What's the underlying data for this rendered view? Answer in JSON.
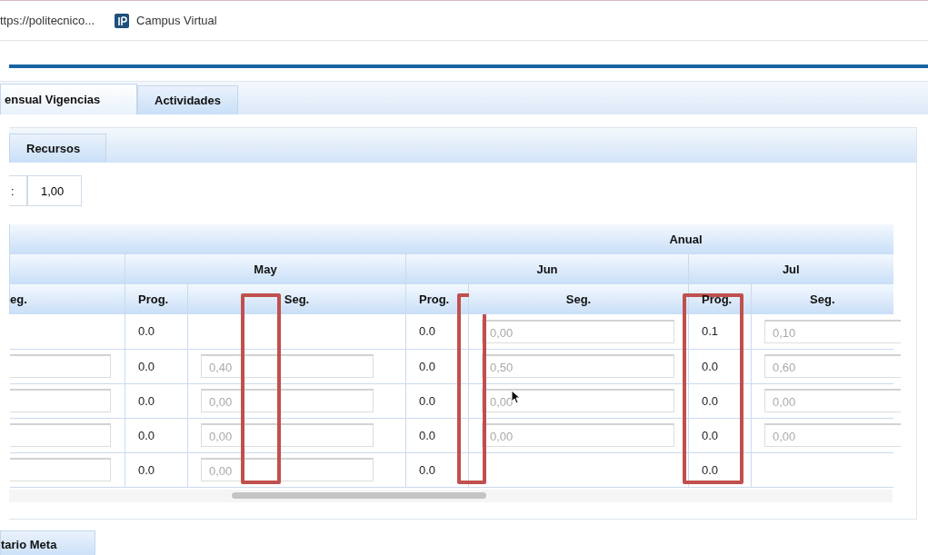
{
  "bookmarks": [
    {
      "label": "ttps://politecnico...",
      "kind": "link"
    },
    {
      "label": "Campus Virtual",
      "kind": "site"
    }
  ],
  "tabs": [
    {
      "label": "ensual Vigencias",
      "selected": true
    },
    {
      "label": "Actividades",
      "selected": false
    }
  ],
  "subtabs": [
    {
      "label": "Recursos",
      "selected": false
    }
  ],
  "field": {
    "label": ":",
    "value": "1,00"
  },
  "table": {
    "group_header": "Anual",
    "months": [
      {
        "label": "May"
      },
      {
        "label": "Jun"
      },
      {
        "label": "Jul"
      }
    ],
    "columns": [
      {
        "label": "eg.",
        "highlighted": false
      },
      {
        "label": "Prog.",
        "highlighted": false
      },
      {
        "label": "Seg.",
        "highlighted": true
      },
      {
        "label": "Prog.",
        "highlighted": true
      },
      {
        "label": "Seg.",
        "highlighted": false
      },
      {
        "label": "Prog.",
        "highlighted": true
      },
      {
        "label": "Seg.",
        "highlighted": false
      }
    ],
    "rows": [
      [
        {
          "kind": "empty"
        },
        {
          "kind": "text",
          "text": "0.0"
        },
        {
          "kind": "empty"
        },
        {
          "kind": "text",
          "text": "0.0"
        },
        {
          "kind": "input",
          "value": "0,00"
        },
        {
          "kind": "text",
          "text": "0.1"
        },
        {
          "kind": "input",
          "value": "0,10"
        }
      ],
      [
        {
          "kind": "input"
        },
        {
          "kind": "text",
          "text": "0.0"
        },
        {
          "kind": "input",
          "value": "0,40"
        },
        {
          "kind": "text",
          "text": "0.0"
        },
        {
          "kind": "input",
          "value": "0,50"
        },
        {
          "kind": "text",
          "text": "0.0"
        },
        {
          "kind": "input",
          "value": "0,60"
        }
      ],
      [
        {
          "kind": "input"
        },
        {
          "kind": "text",
          "text": "0.0"
        },
        {
          "kind": "input",
          "value": "0,00"
        },
        {
          "kind": "text",
          "text": "0.0"
        },
        {
          "kind": "input",
          "value": "0,00"
        },
        {
          "kind": "text",
          "text": "0.0"
        },
        {
          "kind": "input",
          "value": "0,00"
        }
      ],
      [
        {
          "kind": "input"
        },
        {
          "kind": "text",
          "text": "0.0"
        },
        {
          "kind": "input",
          "value": "0,00"
        },
        {
          "kind": "text",
          "text": "0.0"
        },
        {
          "kind": "input",
          "value": "0,00"
        },
        {
          "kind": "text",
          "text": "0.0"
        },
        {
          "kind": "input",
          "value": "0,00"
        }
      ],
      [
        {
          "kind": "input"
        },
        {
          "kind": "text",
          "text": "0.0"
        },
        {
          "kind": "input",
          "value": "0,00"
        },
        {
          "kind": "text",
          "text": "0.0"
        },
        {
          "kind": "empty"
        },
        {
          "kind": "text",
          "text": "0.0"
        },
        {
          "kind": "empty"
        }
      ]
    ],
    "disabled_inputs": true
  },
  "bottom_tab": {
    "label": "tario Meta"
  }
}
